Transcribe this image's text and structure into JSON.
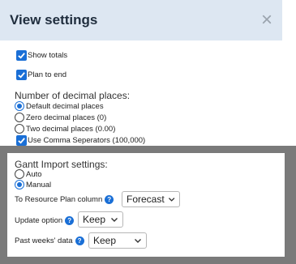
{
  "header": {
    "title": "View settings",
    "close_glyph": "×"
  },
  "options": {
    "show_totals": {
      "label": "Show totals",
      "checked": true
    },
    "plan_to_end": {
      "label": "Plan to end",
      "checked": true
    }
  },
  "decimals": {
    "title": "Number of decimal places:",
    "choices": [
      {
        "label": "Default decimal places",
        "selected": true
      },
      {
        "label": "Zero decimal places (0)",
        "selected": false
      },
      {
        "label": "Two decimal places (0.00)",
        "selected": false
      }
    ],
    "comma": {
      "label": "Use Comma Seperators (100,000)",
      "checked": true
    }
  },
  "gantt": {
    "title": "Gantt Import settings:",
    "choices": [
      {
        "label": "Auto",
        "selected": false
      },
      {
        "label": "Manual",
        "selected": true
      }
    ],
    "fields": [
      {
        "label": "To Resource Plan column",
        "value": "Forecast",
        "help_icon": "question-icon"
      },
      {
        "label": "Update option",
        "value": "Keep",
        "help_icon": "question-icon"
      },
      {
        "label": "Past weeks' data",
        "value": "Keep",
        "help_icon": "question-icon"
      }
    ]
  },
  "colors": {
    "accent": "#1a6fd6",
    "header_bg": "#dde7f2",
    "frame": "#7a7a7a"
  },
  "help_glyph": "?"
}
